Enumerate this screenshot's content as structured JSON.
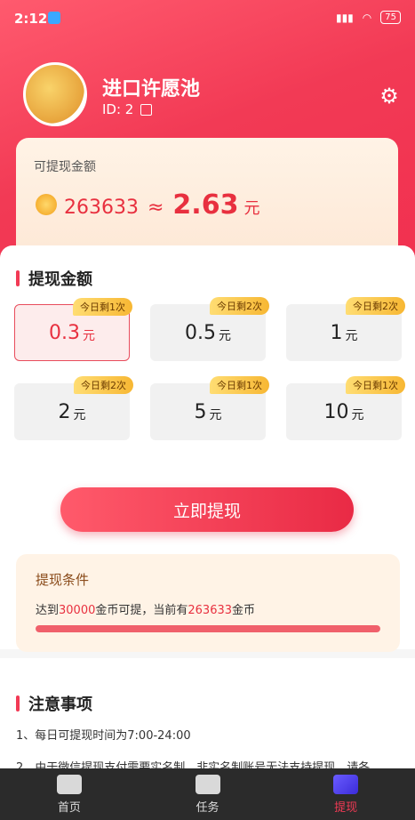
{
  "status_bar": {
    "time": "2:12",
    "battery": "75"
  },
  "profile": {
    "name": "进口许愿池",
    "id_text": "ID: 2"
  },
  "balance": {
    "label": "可提现金额",
    "coins": "263633",
    "approx": "≈",
    "yuan_amount": "2.63",
    "yuan_unit": "元"
  },
  "withdraw": {
    "title": "提现金额",
    "options": [
      {
        "amount": "0.3",
        "unit": "元",
        "badge": "今日剩1次"
      },
      {
        "amount": "0.5",
        "unit": "元",
        "badge": "今日剩2次"
      },
      {
        "amount": "1",
        "unit": "元",
        "badge": "今日剩2次"
      },
      {
        "amount": "2",
        "unit": "元",
        "badge": "今日剩2次"
      },
      {
        "amount": "5",
        "unit": "元",
        "badge": "今日剩1次"
      },
      {
        "amount": "10",
        "unit": "元",
        "badge": "今日剩1次"
      }
    ],
    "selected_index": 0,
    "button_label": "立即提现"
  },
  "conditions": {
    "title": "提现条件",
    "text_prefix": "达到",
    "required": "30000",
    "text_mid": "金币可提，当前有",
    "current": "263633",
    "text_suffix": "金币",
    "progress": 1.0
  },
  "notes": {
    "title": "注意事项",
    "items": [
      "1、每日可提现时间为7:00-24:00",
      "2、由于微信提现支付需要实名制，非实名制账号无法支持提现，请各"
    ]
  },
  "tabbar": {
    "items": [
      {
        "label": "首页",
        "icon": "home-icon"
      },
      {
        "label": "任务",
        "icon": "task-icon"
      },
      {
        "label": "提现",
        "icon": "withdraw-icon"
      }
    ],
    "active_index": 2
  },
  "colors": {
    "accent": "#f23a55",
    "badge": "#f7b733"
  }
}
